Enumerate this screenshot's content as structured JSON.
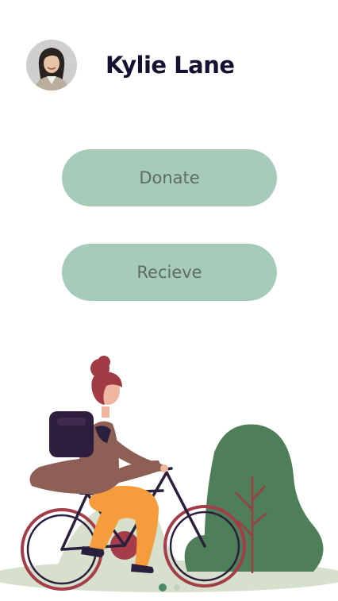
{
  "profile": {
    "name": "Kylie Lane",
    "avatar_icon": "user-photo"
  },
  "actions": {
    "donate_label": "Donate",
    "receive_label": "Recieve"
  },
  "pager": {
    "total_pages": 2,
    "active_page": 1
  },
  "colors": {
    "button_bg": "#a7cbb9",
    "button_text": "#5e6b66",
    "name_text": "#161130",
    "bush": "#4e7f58",
    "ground": "#d6e0cc",
    "hair": "#a23a45",
    "wheel": "#a53c4a"
  }
}
